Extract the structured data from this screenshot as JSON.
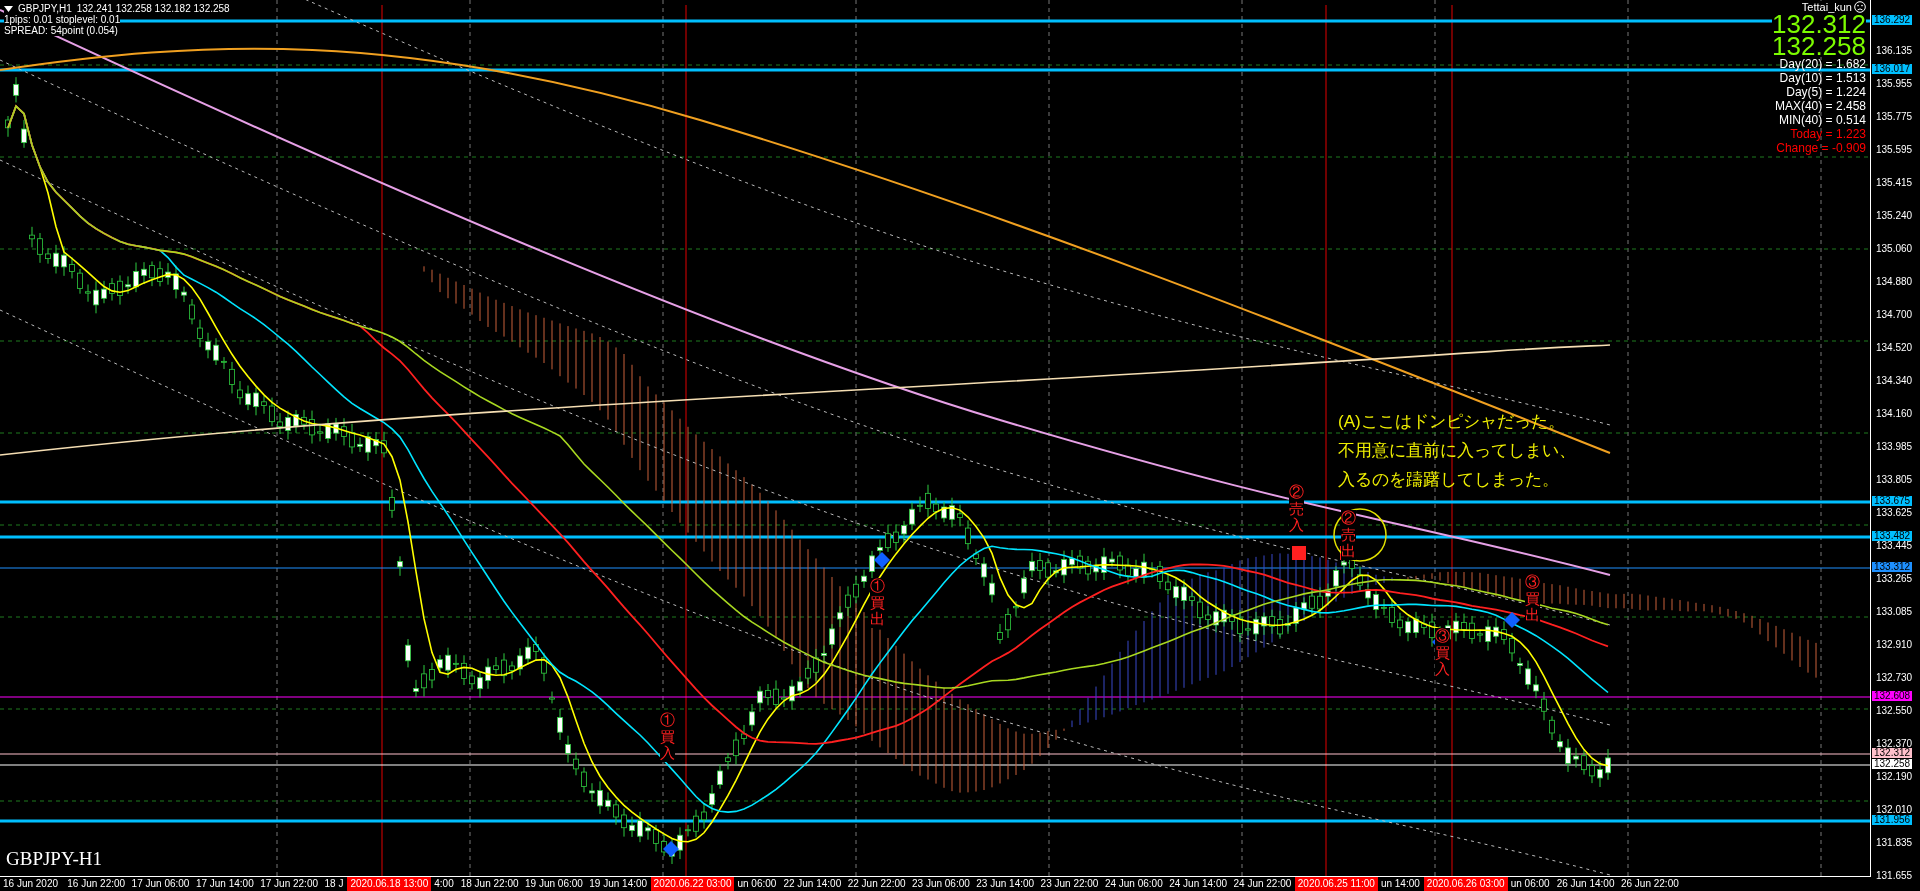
{
  "header": {
    "symbol": "GBPJPY,H1",
    "quote": "132.241 132.258 132.182 132.258",
    "info": [
      "1pips: 0.01  stoplevel: 0.01",
      "SPREAD: 54point (0.054)"
    ]
  },
  "user": {
    "name": "Tettai_kun"
  },
  "big_prices": [
    "132.312",
    "132.258"
  ],
  "stats": [
    {
      "text": "Day(20) = 1.682",
      "color": "#ffffff"
    },
    {
      "text": "Day(10) = 1.513",
      "color": "#ffffff"
    },
    {
      "text": "Day(5) = 1.224",
      "color": "#ffffff"
    },
    {
      "text": "MAX(40) = 2.458",
      "color": "#ffffff"
    },
    {
      "text": "MIN(40) = 0.514",
      "color": "#ffffff"
    },
    {
      "text": "Today = 1.223",
      "color": "#ff0000"
    },
    {
      "text": "Change = -0.909",
      "color": "#ff0000"
    }
  ],
  "chart_label": "GBPJPY-H1",
  "note": [
    "(A)ここはドンピシャだった。",
    "不用意に直前に入ってしまい、",
    "入るのを躊躇してしまった。"
  ],
  "trade_marks": [
    "①買入",
    "①買出",
    "②売入",
    "②売出",
    "③買入",
    "③買出"
  ],
  "price_axis": {
    "ticks": [
      "136.135",
      "135.955",
      "135.775",
      "135.595",
      "135.415",
      "135.240",
      "135.060",
      "134.880",
      "134.700",
      "134.520",
      "134.340",
      "134.160",
      "133.985",
      "133.805",
      "133.625",
      "133.445",
      "133.265",
      "133.085",
      "132.910",
      "132.730",
      "132.550",
      "132.370",
      "132.190",
      "132.010",
      "131.835",
      "131.655"
    ],
    "price_tags": [
      {
        "value": "136.292",
        "color": "#00bfff",
        "kind": "thick"
      },
      {
        "value": "136.017",
        "color": "#00bfff",
        "kind": "thick"
      },
      {
        "value": "133.675",
        "color": "#00bfff",
        "kind": "thick"
      },
      {
        "value": "133.482",
        "color": "#00bfff",
        "kind": "thick"
      },
      {
        "value": "133.312",
        "color": "#1e90ff",
        "kind": "thin"
      },
      {
        "value": "132.608",
        "color": "#ff00ff",
        "kind": "thin"
      },
      {
        "value": "132.312",
        "color": "#ffc0cb",
        "kind": "thin"
      },
      {
        "value": "132.258",
        "color": "#ffffff",
        "kind": "thin"
      },
      {
        "value": "131.956",
        "color": "#00bfff",
        "kind": "thick"
      }
    ]
  },
  "time_axis": [
    {
      "kind": "label",
      "text": "16 Jun 2020"
    },
    {
      "kind": "label",
      "text": "16 Jun 22:00"
    },
    {
      "kind": "label",
      "text": "17 Jun 06:00"
    },
    {
      "kind": "label",
      "text": "17 Jun 14:00"
    },
    {
      "kind": "label",
      "text": "17 Jun 22:00"
    },
    {
      "kind": "fragment",
      "text": "18 J"
    },
    {
      "kind": "marker",
      "text": "2020.06.18 13:00"
    },
    {
      "kind": "fragment",
      "text": "4:00"
    },
    {
      "kind": "label",
      "text": "18 Jun 22:00"
    },
    {
      "kind": "label",
      "text": "19 Jun 06:00"
    },
    {
      "kind": "label",
      "text": "19 Jun 14:00"
    },
    {
      "kind": "marker",
      "text": "2020.06.22 03:00"
    },
    {
      "kind": "fragment",
      "text": "un 06:00"
    },
    {
      "kind": "label",
      "text": "22 Jun 14:00"
    },
    {
      "kind": "label",
      "text": "22 Jun 22:00"
    },
    {
      "kind": "label",
      "text": "23 Jun 06:00"
    },
    {
      "kind": "label",
      "text": "23 Jun 14:00"
    },
    {
      "kind": "label",
      "text": "23 Jun 22:00"
    },
    {
      "kind": "label",
      "text": "24 Jun 06:00"
    },
    {
      "kind": "label",
      "text": "24 Jun 14:00"
    },
    {
      "kind": "label",
      "text": "24 Jun 22:00"
    },
    {
      "kind": "marker",
      "text": "2020.06.25 11:00"
    },
    {
      "kind": "fragment",
      "text": "un 14:00"
    },
    {
      "kind": "marker",
      "text": "2020.06.26 03:00"
    },
    {
      "kind": "fragment",
      "text": "un 06:00"
    },
    {
      "kind": "label",
      "text": "26 Jun 14:00"
    },
    {
      "kind": "label",
      "text": "26 Jun 22:00"
    }
  ]
}
